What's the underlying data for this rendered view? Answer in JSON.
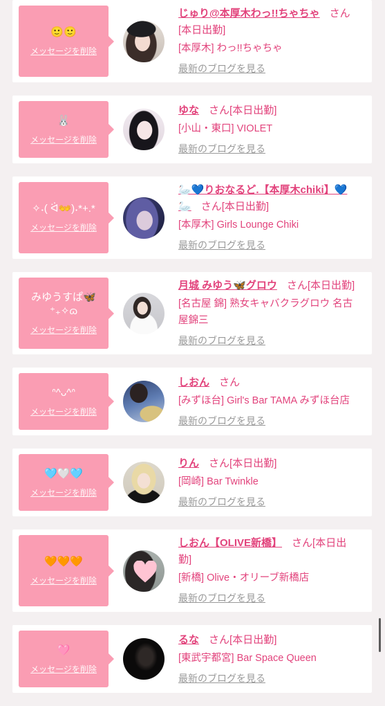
{
  "colors": {
    "bubble": "#fa9db3",
    "accent_pink": "#e2437c",
    "link_gray": "#9a9a9a"
  },
  "labels": {
    "delete_message": "メッセージを削除",
    "latest_blog": "最新のブログを見る",
    "honorific": "さん"
  },
  "cards": [
    {
      "message": "🙂🙂",
      "name": "じゅり@本厚木わっ!!ちゃちゃ",
      "status": "[本日出勤]",
      "store": "[本厚木] わっ!!ちゃちゃ"
    },
    {
      "message": "🐰",
      "name": "ゆな",
      "status": "[本日出勤]",
      "store": "[小山・東口] VIOLET"
    },
    {
      "message": "✧˖( ᐛ👐)˖*+.*",
      "name": "🦢💙りおなるど.【本厚木chiki】💙🦢",
      "status": "[本日出勤]",
      "store": "[本厚木] Girls Lounge Chiki"
    },
    {
      "message": "みゆうすぱ🦋\n⁺₊✧ɷ",
      "name": "月城 みゆう🦋グロウ",
      "status": "[本日出勤]",
      "store": "[名古屋 錦] 熟女キャバクラグロウ 名古屋錦三"
    },
    {
      "message": "ᐢ^ᴗ^ᐢ",
      "name": "しおん",
      "store": "[みずほ台] Girl's Bar TAMA みずほ台店"
    },
    {
      "message": "🩵🤍🩵",
      "name": "りん",
      "status": "[本日出勤]",
      "store": "[岡崎] Bar Twinkle"
    },
    {
      "message": "🧡🧡🧡",
      "name": "しおん【OLIVE新橋】",
      "status": "[本日出勤]",
      "store": "[新橋] Olive・オリーブ新橋店"
    },
    {
      "message": "🩷",
      "name": "るな",
      "status": "[本日出勤]",
      "store": "[東武宇都宮] Bar Space Queen"
    }
  ]
}
